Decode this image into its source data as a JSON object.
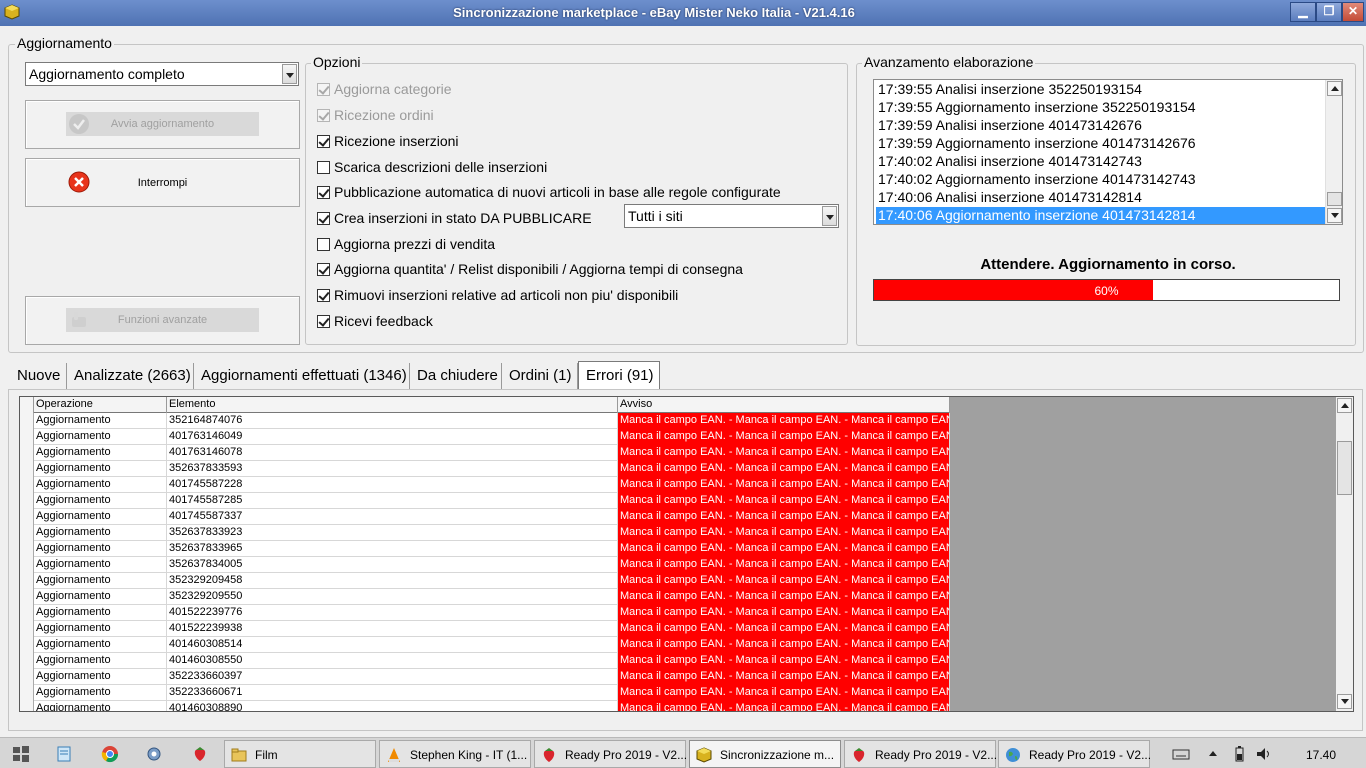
{
  "window": {
    "title": "Sincronizzazione marketplace - eBay Mister Neko Italia - V21.4.16",
    "minimize_glyph": "▁",
    "maximize_glyph": "❐",
    "close_glyph": "✕"
  },
  "update_group": {
    "label": "Aggiornamento",
    "mode_selected": "Aggiornamento completo",
    "start_button": "Avvia aggiornamento",
    "stop_button": "Interrompi",
    "advanced_button": "Funzioni avanzate"
  },
  "options_group": {
    "label": "Opzioni",
    "site_selected": "Tutti i siti",
    "items": [
      {
        "label": "Aggiorna categorie",
        "checked": true,
        "enabled": false
      },
      {
        "label": "Ricezione ordini",
        "checked": true,
        "enabled": false
      },
      {
        "label": "Ricezione inserzioni",
        "checked": true,
        "enabled": true
      },
      {
        "label": "Scarica descrizioni delle inserzioni",
        "checked": false,
        "enabled": true
      },
      {
        "label": "Pubblicazione automatica di nuovi articoli in base alle regole configurate",
        "checked": true,
        "enabled": true
      },
      {
        "label": "Crea inserzioni in stato DA PUBBLICARE",
        "checked": true,
        "enabled": true
      },
      {
        "label": "Aggiorna prezzi di vendita",
        "checked": false,
        "enabled": true
      },
      {
        "label": "Aggiorna quantita' / Relist disponibili / Aggiorna tempi di consegna",
        "checked": true,
        "enabled": true
      },
      {
        "label": "Rimuovi inserzioni relative ad articoli non piu' disponibili",
        "checked": true,
        "enabled": true
      },
      {
        "label": "Ricevi feedback",
        "checked": true,
        "enabled": true
      }
    ]
  },
  "progress_group": {
    "label": "Avanzamento elaborazione",
    "log": [
      "17:39:55 Analisi inserzione 352250193154",
      "17:39:55 Aggiornamento inserzione 352250193154",
      "17:39:59 Analisi inserzione 401473142676",
      "17:39:59 Aggiornamento inserzione 401473142676",
      "17:40:02 Analisi inserzione 401473142743",
      "17:40:02 Aggiornamento inserzione 401473142743",
      "17:40:06 Analisi inserzione 401473142814",
      "17:40:06 Aggiornamento inserzione 401473142814"
    ],
    "selected_index": 7,
    "status": "Attendere. Aggiornamento in corso.",
    "percent": 60,
    "percent_text": "60%",
    "bar_color": "#ff0000"
  },
  "tabs": [
    {
      "label": "Nuove"
    },
    {
      "label": "Analizzate (2663)"
    },
    {
      "label": "Aggiornamenti effettuati (1346)"
    },
    {
      "label": "Da chiudere"
    },
    {
      "label": "Ordini (1)"
    },
    {
      "label": "Errori (91)"
    }
  ],
  "active_tab": 5,
  "grid": {
    "columns": [
      "Operazione",
      "Elemento",
      "Avviso"
    ],
    "warning_text": "Manca il campo EAN. - Manca il campo EAN. - Manca il campo EAN...",
    "rows": [
      [
        "Aggiornamento",
        "352164874076"
      ],
      [
        "Aggiornamento",
        "401763146049"
      ],
      [
        "Aggiornamento",
        "401763146078"
      ],
      [
        "Aggiornamento",
        "352637833593"
      ],
      [
        "Aggiornamento",
        "401745587228"
      ],
      [
        "Aggiornamento",
        "401745587285"
      ],
      [
        "Aggiornamento",
        "401745587337"
      ],
      [
        "Aggiornamento",
        "352637833923"
      ],
      [
        "Aggiornamento",
        "352637833965"
      ],
      [
        "Aggiornamento",
        "352637834005"
      ],
      [
        "Aggiornamento",
        "352329209458"
      ],
      [
        "Aggiornamento",
        "352329209550"
      ],
      [
        "Aggiornamento",
        "401522239776"
      ],
      [
        "Aggiornamento",
        "401522239938"
      ],
      [
        "Aggiornamento",
        "401460308514"
      ],
      [
        "Aggiornamento",
        "401460308550"
      ],
      [
        "Aggiornamento",
        "352233660397"
      ],
      [
        "Aggiornamento",
        "352233660671"
      ],
      [
        "Aggiornamento",
        "401460308890"
      ]
    ],
    "warning_color": "#ff0000"
  },
  "taskbar": {
    "tasks": [
      {
        "label": "Film",
        "icon": "folder-icon"
      },
      {
        "label": "Stephen King - IT (1...",
        "icon": "vlc-icon"
      },
      {
        "label": "Ready Pro 2019 - V2...",
        "icon": "strawberry-icon"
      },
      {
        "label": "Sincronizzazione m...",
        "icon": "cube-icon",
        "active": true
      },
      {
        "label": "Ready Pro 2019 - V2...",
        "icon": "strawberry-icon"
      },
      {
        "label": "Ready Pro 2019 - V2...",
        "icon": "globe-icon"
      }
    ],
    "clock": "17.40"
  }
}
